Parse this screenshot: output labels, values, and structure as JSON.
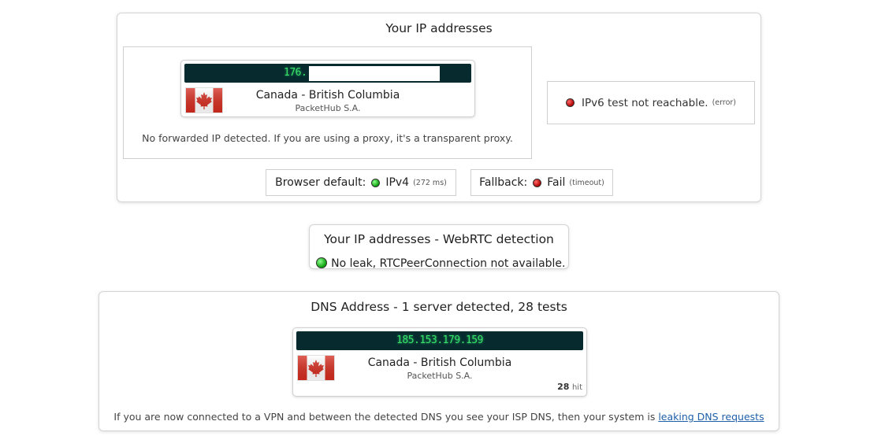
{
  "ip_panel": {
    "title": "Your IP addresses",
    "ipv4": {
      "ip_visible": "176.",
      "location": "Canada - British Columbia",
      "isp": "PacketHub S.A.",
      "flag_icon": "canada-flag-icon"
    },
    "forwarded_note": "No forwarded IP detected. If you are using a proxy, it's a transparent proxy.",
    "ipv6": {
      "text": "IPv6 test not reachable.",
      "detail": "(error)",
      "status_color": "#c00000"
    },
    "browser_default": {
      "label": "Browser default:",
      "value": "IPv4",
      "detail": "(272 ms)",
      "status_color": "#0a9e0a"
    },
    "fallback": {
      "label": "Fallback:",
      "value": "Fail",
      "detail": "(timeout)",
      "status_color": "#c00000"
    }
  },
  "webrtc_panel": {
    "title": "Your IP addresses - WebRTC detection",
    "status_text": "No leak, RTCPeerConnection not available.",
    "status_color": "#0a9e0a"
  },
  "dns_panel": {
    "title": "DNS Address - 1 server detected, 28 tests",
    "server": {
      "ip": "185.153.179.159",
      "location": "Canada - British Columbia",
      "isp": "PacketHub S.A.",
      "hits": "28",
      "hits_label": "hit",
      "flag_icon": "canada-flag-icon"
    },
    "footer_text": "If you are now connected to a VPN and between the detected DNS you see your ISP DNS, then your system is ",
    "footer_link": "leaking DNS requests"
  },
  "colors": {
    "ip_bar_bg": "#062a2e",
    "ip_text": "#37e36a",
    "link": "#1f5fa8"
  }
}
